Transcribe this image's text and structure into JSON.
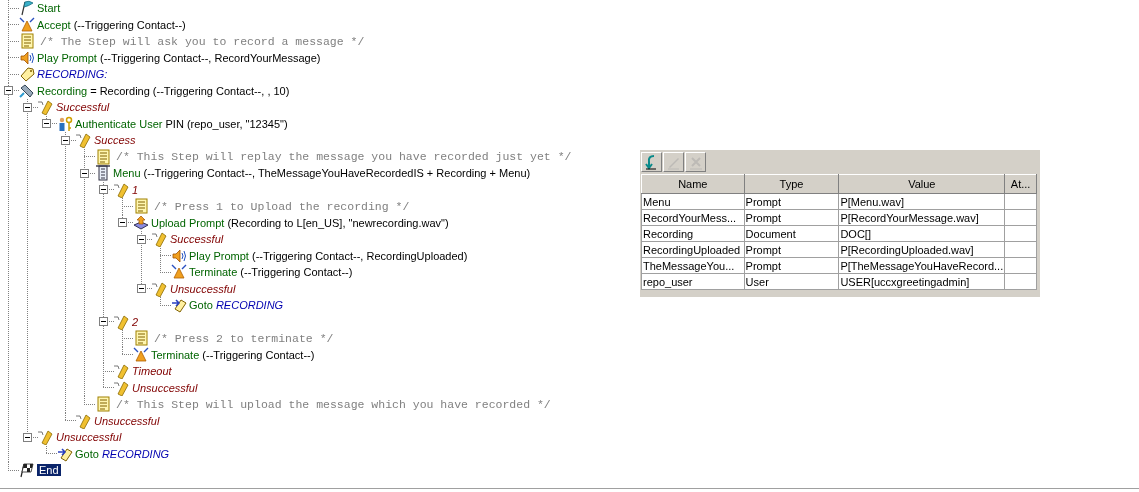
{
  "tree": {
    "nodes": [
      {
        "kind": "start",
        "name": "Start",
        "selected": false
      },
      {
        "kind": "accept",
        "name": "Accept",
        "args": "(--Triggering Contact--)",
        "selected": false
      },
      {
        "kind": "comment",
        "text": "/* The Step will ask you to record a message */",
        "selected": false
      },
      {
        "kind": "prompt",
        "name": "Play Prompt",
        "args": "(--Triggering Contact--, RecordYourMessage)",
        "selected": false
      },
      {
        "kind": "label",
        "name": "RECORDING:",
        "selected": false
      },
      {
        "kind": "recording",
        "name": "Recording",
        "args": "= Recording (--Triggering Contact--, , 10)",
        "expanded": true,
        "selected": false,
        "children": [
          {
            "kind": "branch",
            "name": "Successful",
            "expanded": true,
            "selected": false,
            "children": [
              {
                "kind": "auth",
                "name": "Authenticate User",
                "args": "PIN (repo_user, \"12345\")",
                "expanded": true,
                "selected": false,
                "children": [
                  {
                    "kind": "branch",
                    "name": "Success",
                    "expanded": true,
                    "selected": false,
                    "children": [
                      {
                        "kind": "comment",
                        "text": "/* This Step will replay the message you have recorded just yet */",
                        "selected": false
                      },
                      {
                        "kind": "menu",
                        "name": "Menu",
                        "args": "(--Triggering Contact--, TheMessageYouHaveRecordedIS + Recording + Menu)",
                        "expanded": true,
                        "selected": false,
                        "children": [
                          {
                            "kind": "branch",
                            "name": "1",
                            "expanded": true,
                            "selected": false,
                            "children": [
                              {
                                "kind": "comment",
                                "text": "/* Press 1 to Upload the recording */",
                                "selected": false
                              },
                              {
                                "kind": "upload",
                                "name": "Upload Prompt",
                                "args": "(Recording to L[en_US], \"newrecording.wav\")",
                                "expanded": true,
                                "selected": false,
                                "children": [
                                  {
                                    "kind": "branch",
                                    "name": "Successful",
                                    "expanded": true,
                                    "selected": false,
                                    "children": [
                                      {
                                        "kind": "prompt",
                                        "name": "Play Prompt",
                                        "args": "(--Triggering Contact--, RecordingUploaded)",
                                        "selected": false
                                      },
                                      {
                                        "kind": "terminate",
                                        "name": "Terminate",
                                        "args": "(--Triggering Contact--)",
                                        "selected": false
                                      }
                                    ]
                                  },
                                  {
                                    "kind": "branch",
                                    "name": "Unsuccessful",
                                    "expanded": true,
                                    "selected": false,
                                    "children": [
                                      {
                                        "kind": "goto",
                                        "name": "Goto",
                                        "target": "RECORDING",
                                        "selected": false
                                      }
                                    ]
                                  }
                                ]
                              }
                            ]
                          },
                          {
                            "kind": "branch",
                            "name": "2",
                            "expanded": true,
                            "selected": false,
                            "children": [
                              {
                                "kind": "comment",
                                "text": "/* Press 2 to terminate */",
                                "selected": false
                              },
                              {
                                "kind": "terminate",
                                "name": "Terminate",
                                "args": "(--Triggering Contact--)",
                                "selected": false
                              }
                            ]
                          },
                          {
                            "kind": "branch",
                            "name": "Timeout",
                            "selected": false
                          },
                          {
                            "kind": "branch",
                            "name": "Unsuccessful",
                            "selected": false
                          }
                        ]
                      },
                      {
                        "kind": "comment",
                        "text": "/* This Step will upload the message which you have recorded */",
                        "selected": false
                      }
                    ]
                  },
                  {
                    "kind": "branch",
                    "name": "Unsuccessful",
                    "selected": false
                  }
                ]
              }
            ]
          },
          {
            "kind": "branch",
            "name": "Unsuccessful",
            "expanded": true,
            "selected": false,
            "children": [
              {
                "kind": "goto",
                "name": "Goto",
                "target": "RECORDING",
                "selected": false
              }
            ]
          }
        ]
      },
      {
        "kind": "end",
        "name": "End",
        "selected": true
      }
    ]
  },
  "variables": {
    "toolbar": [
      {
        "kind": "add",
        "disabled": false
      },
      {
        "kind": "edit",
        "disabled": true
      },
      {
        "kind": "delete",
        "disabled": true
      }
    ],
    "columns": [
      "Name",
      "Type",
      "Value",
      "At..."
    ],
    "rows": [
      {
        "name": "Menu",
        "type": "Prompt",
        "value": "P[Menu.wav]"
      },
      {
        "name": "RecordYourMess...",
        "type": "Prompt",
        "value": "P[RecordYourMessage.wav]"
      },
      {
        "name": "Recording",
        "type": "Document",
        "value": "DOC[]"
      },
      {
        "name": "RecordingUploaded",
        "type": "Prompt",
        "value": "P[RecordingUploaded.wav]"
      },
      {
        "name": "TheMessageYou...",
        "type": "Prompt",
        "value": "P[TheMessageYouHaveRecord..."
      },
      {
        "name": "repo_user",
        "type": "User",
        "value": "USER[uccxgreetingadmin]"
      }
    ]
  }
}
